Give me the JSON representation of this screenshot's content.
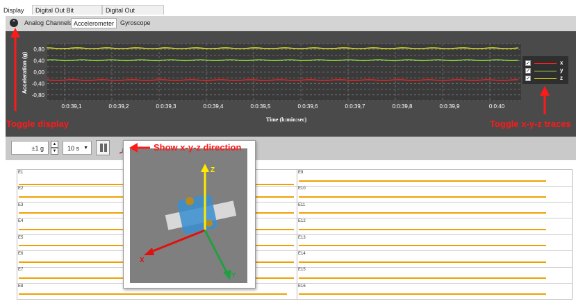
{
  "top_tabs": [
    {
      "label": "Display",
      "active": true
    },
    {
      "label": "Digital Out Bit Selection",
      "active": false
    },
    {
      "label": "Digital Out Generator",
      "active": false
    }
  ],
  "sub_tabs": [
    {
      "label": "Analog Channels",
      "active": false
    },
    {
      "label": "Accelerometer",
      "active": true
    },
    {
      "label": "Gyroscope",
      "active": false
    }
  ],
  "chart_data": {
    "type": "line",
    "ylabel": "Acceleration (g)",
    "xlabel": "Time (h:min:sec)",
    "y_ticks": [
      "0,80",
      "0,40",
      "0,00",
      "-0,40",
      "-0,80"
    ],
    "x_ticks": [
      "0:0:39,1",
      "0:0:39,2",
      "0:0:39,3",
      "0:0:39,4",
      "0:0:39,5",
      "0:0:39,6",
      "0:0:39,7",
      "0:0:39,8",
      "0:0:39,9",
      "0:0:40"
    ],
    "ylim": [
      -1.0,
      1.0
    ],
    "grid": true,
    "legend_position": "right",
    "series": [
      {
        "name": "x",
        "color": "#ff2020",
        "value": -0.28
      },
      {
        "name": "y",
        "color": "#e6f020",
        "value": 0.84
      },
      {
        "name": "z",
        "color": "#8ee03a",
        "value": 0.42
      }
    ]
  },
  "legend": [
    {
      "label": "x",
      "checked": true,
      "color": "#ff2020"
    },
    {
      "label": "y",
      "checked": true,
      "color": "#9be54a"
    },
    {
      "label": "z",
      "checked": true,
      "color": "#e6f020"
    }
  ],
  "controls": {
    "range_value": "±1 g",
    "stepper_up": "▲",
    "stepper_down": "▼",
    "time_value": "10 s",
    "time_caret": "▼"
  },
  "digital_channels": {
    "left": [
      {
        "label": "E1",
        "level": 0.3
      },
      {
        "label": "E2",
        "level": 0.55
      },
      {
        "label": "E3",
        "level": 0.55
      },
      {
        "label": "E4",
        "level": 0.55
      },
      {
        "label": "E5",
        "level": 0.55
      },
      {
        "label": "E6",
        "level": 0.55
      },
      {
        "label": "E7",
        "level": 0.55
      },
      {
        "label": "E8",
        "level": 0.55
      }
    ],
    "right": [
      {
        "label": "E9",
        "level": 0.55
      },
      {
        "label": "E10",
        "level": 0.55
      },
      {
        "label": "E11",
        "level": 0.55
      },
      {
        "label": "E12",
        "level": 0.55
      },
      {
        "label": "E13",
        "level": 0.55
      },
      {
        "label": "E14",
        "level": 0.55
      },
      {
        "label": "E15",
        "level": 0.55
      },
      {
        "label": "E16",
        "level": 0.55
      }
    ]
  },
  "popup": {
    "axis_x": "X",
    "axis_y": "Y",
    "axis_z": "Z"
  },
  "annotations": {
    "toggle_display": "Toggle display",
    "toggle_traces": "Toggle x-y-z traces",
    "show_direction": "Show x-y-z direction"
  },
  "colors": {
    "annotation": "#ff1a1a",
    "digital_trace": "#f0a000",
    "chart_bg": "#4a4a4a"
  }
}
